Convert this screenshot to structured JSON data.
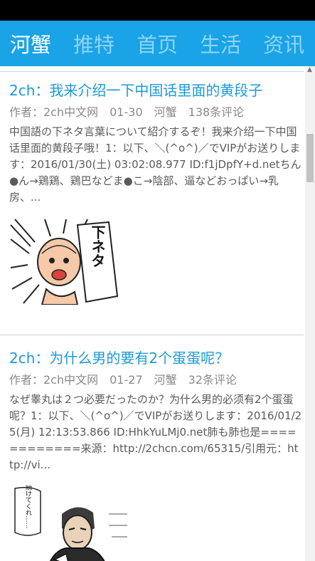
{
  "tabs": [
    {
      "label": "河蟹",
      "active": true
    },
    {
      "label": "推特",
      "active": false
    },
    {
      "label": "首页",
      "active": false
    },
    {
      "label": "生活",
      "active": false
    },
    {
      "label": "资讯",
      "active": false
    }
  ],
  "articles": [
    {
      "title": "2ch：我来介绍一下中国话里面的黄段子",
      "author": "作者：2ch中文网",
      "date": "01-30",
      "category": "河蟹",
      "comments": "138条评论",
      "excerpt": "中国語の下ネタ言葉について紹介するぞ！我来介绍一下中国话里面的黄段子哦！1：以下、＼(^o^)／でVIPがお送りします：2016/01/30(土) 03:02:08.977 ID:f1jDpfY+d.netちん●ん→鶏鶏、鶏巴などま●こ→陰部、逼などおっぱい→乳房、...",
      "thumb_text": "下ネタ"
    },
    {
      "title": "2ch：为什么男的要有2个蛋蛋呢？",
      "author": "作者：2ch中文网",
      "date": "01-27",
      "category": "河蟹",
      "comments": "32条评论",
      "excerpt": "なぜ睾丸は２つ必要だったのか？为什么男的必须有2个蛋蛋呢？1：以下、＼(^o^)／でVIPがお送りします：2016/01/25(月) 12:13:53.866 ID:HhkYuLMj0.net肺も肺也是============来源：http://2chcn.com/65315/引用元：http://vi...",
      "thumb_text": "……続けてくれ……"
    }
  ],
  "colors": {
    "accent": "#1aa3e6",
    "title": "#1b9ad8",
    "inactive_tab": "#8fd4f5"
  }
}
